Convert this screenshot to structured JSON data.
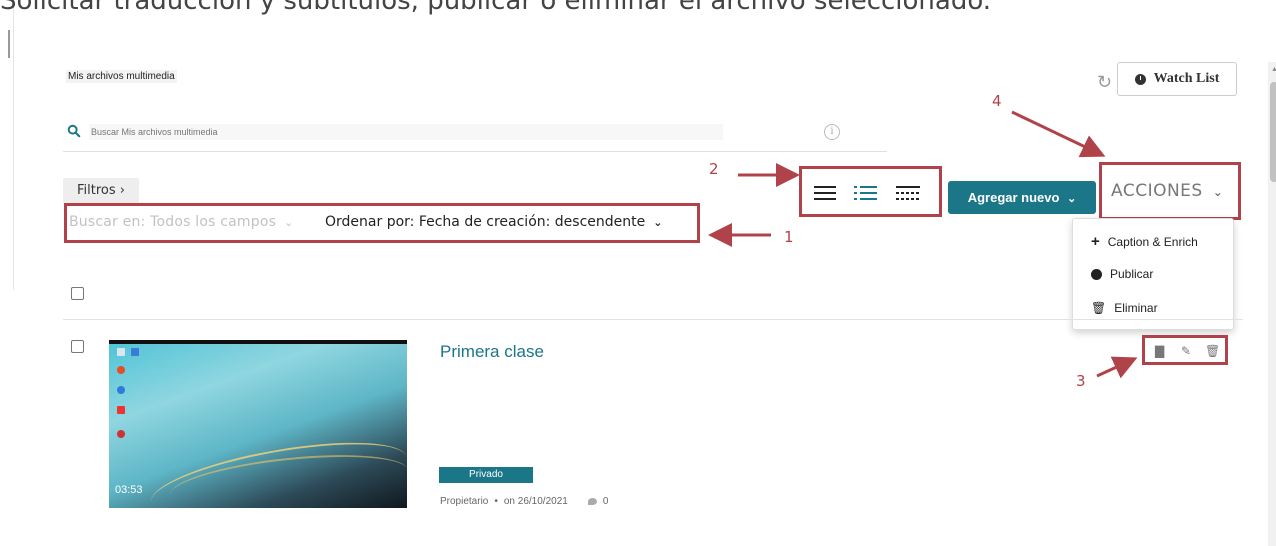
{
  "caption": "Solicitar traducción y subtítulos, publicar o eliminar el archivo seleccionado.",
  "header": {
    "page_title": "Mis archivos multimedia",
    "watch_list_label": "Watch List"
  },
  "search": {
    "placeholder": "Buscar Mis archivos multimedia"
  },
  "toolbar": {
    "filters_label": "Filtros ›",
    "search_in_label": "Buscar en: Todos los campos",
    "sort_by_label": "Ordenar por: Fecha de creación: descendente",
    "add_new_label": "Agregar nuevo",
    "actions_label": "ACCIONES"
  },
  "actions_menu": {
    "items": [
      {
        "label": "Caption & Enrich",
        "icon": "plus-icon"
      },
      {
        "label": "Publicar",
        "icon": "globe-icon"
      },
      {
        "label": "Eliminar",
        "icon": "trash-icon"
      }
    ]
  },
  "media_items": [
    {
      "title": "Primera clase",
      "duration": "03:53",
      "status": "Privado",
      "owner": "Propietario",
      "separator": "•",
      "date": "on 26/10/2021",
      "comments": "0"
    }
  ],
  "annotations": {
    "n1": "1",
    "n2": "2",
    "n3": "3",
    "n4": "4"
  },
  "colors": {
    "accent": "#1b7688",
    "highlight_box": "#b0434a"
  }
}
